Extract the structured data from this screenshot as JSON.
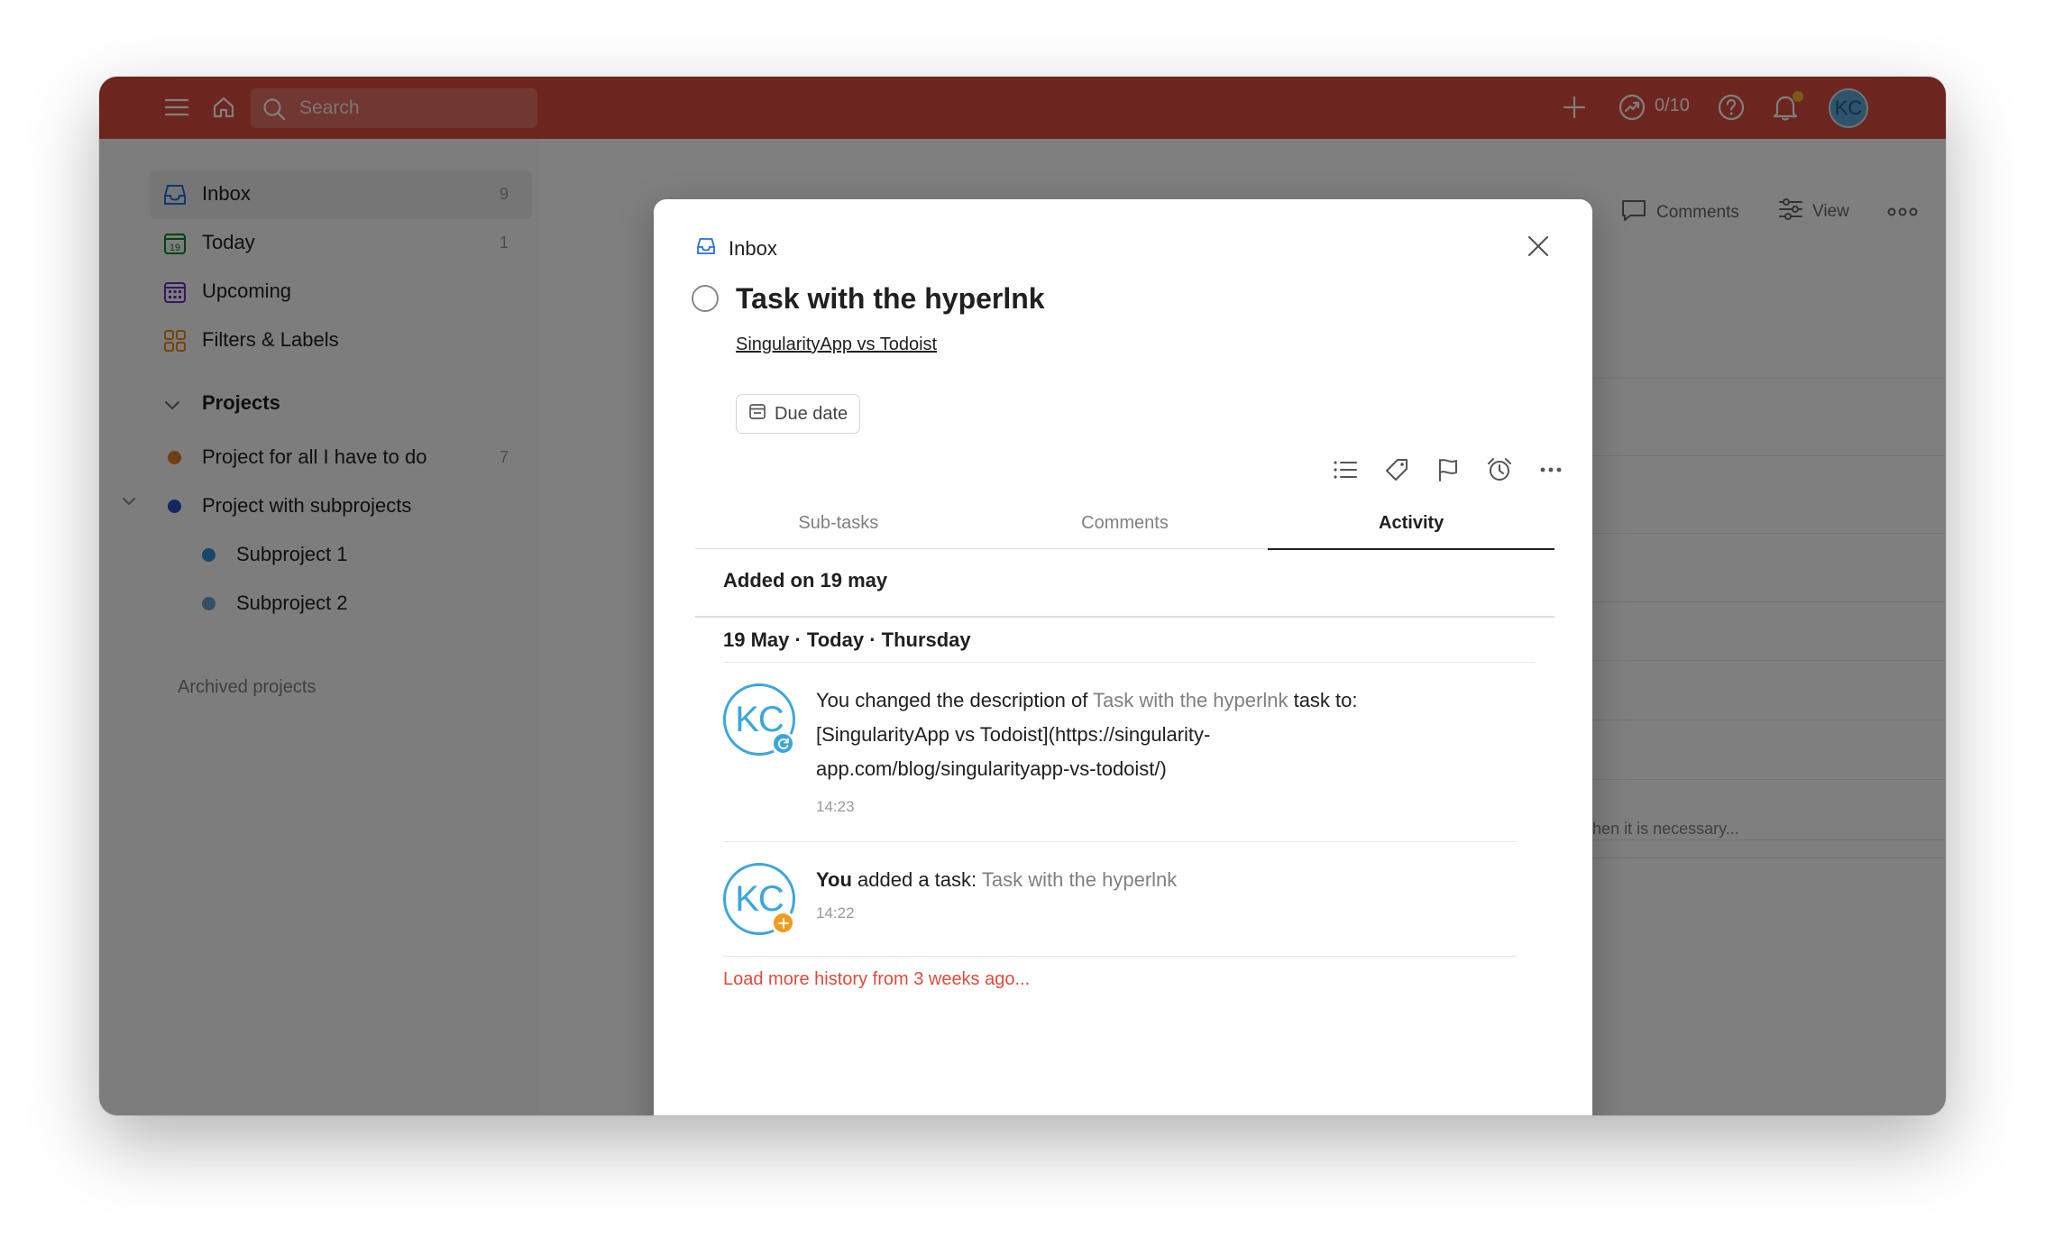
{
  "topbar": {
    "search_placeholder": "Search",
    "karma": "0/10",
    "avatar_initials": "KC",
    "accent_color": "#db4c3f"
  },
  "sidebar": {
    "items": [
      {
        "label": "Inbox",
        "count": "9",
        "icon": "inbox-icon"
      },
      {
        "label": "Today",
        "count": "1",
        "icon": "calendar-today-icon"
      },
      {
        "label": "Upcoming",
        "count": "",
        "icon": "calendar-grid-icon"
      },
      {
        "label": "Filters & Labels",
        "count": "",
        "icon": "filters-grid-icon"
      }
    ],
    "projects_heading": "Projects",
    "projects": [
      {
        "label": "Project for all I have to do",
        "count": "7",
        "color": "#e07b2f"
      },
      {
        "label": "Project with subprojects",
        "count": "",
        "color": "#2b4fc4"
      },
      {
        "label": "Subproject 1",
        "count": "",
        "color": "#2f8fd8"
      },
      {
        "label": "Subproject 2",
        "count": "",
        "color": "#6a9fc9"
      }
    ],
    "archived": "Archived projects"
  },
  "main": {
    "comments_label": "Comments",
    "view_label": "View",
    "bg_description": "for example, when it is necessary..."
  },
  "modal": {
    "breadcrumb": "Inbox",
    "title": "Task with the hyperlnk",
    "link_text": "SingularityApp vs Todoist",
    "due_date_label": "Due date",
    "tabs": [
      {
        "label": "Sub-tasks",
        "active": false
      },
      {
        "label": "Comments",
        "active": false
      },
      {
        "label": "Activity",
        "active": true
      }
    ],
    "added_on": "Added on 19 may",
    "date_heading": "19 May · Today · Thursday",
    "activities": [
      {
        "avatar": "KC",
        "badge": "sync-icon",
        "badge_color": "#3ba6de",
        "prefix": "You changed the description of ",
        "task_ref": "Task with the hyperlnk",
        "suffix": " task to: [SingularityApp vs Todoist](https://singularity-app.com/blog/singularityapp-vs-todoist/)",
        "time": "14:23"
      },
      {
        "avatar": "KC",
        "badge": "plus-icon",
        "badge_color": "#f29a20",
        "actor": "You",
        "prefix": " added a task: ",
        "task_ref": "Task with the hyperlnk",
        "time": "14:22"
      }
    ],
    "load_more": "Load more history from 3 weeks ago...",
    "load_more_color": "#dc4c3e"
  }
}
